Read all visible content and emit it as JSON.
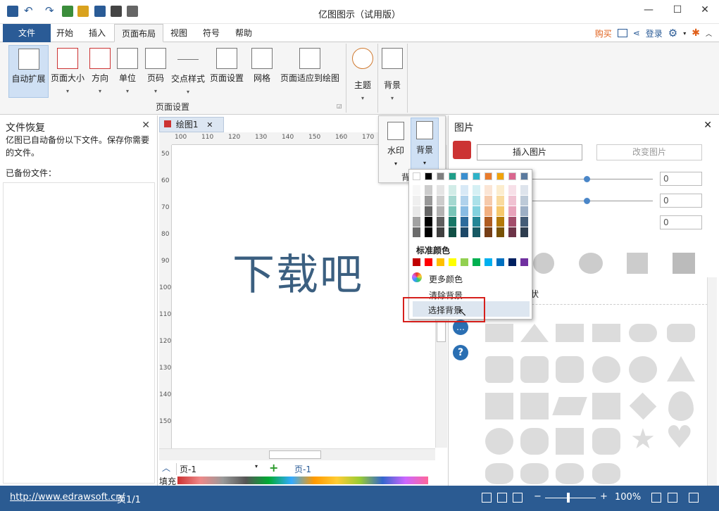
{
  "app": {
    "title": "亿图图示（试用版）"
  },
  "window_controls": {
    "minimize": "—",
    "maximize": "☐",
    "close": "✕"
  },
  "menu": {
    "tabs": [
      "文件",
      "开始",
      "插入",
      "页面布局",
      "视图",
      "符号",
      "帮助"
    ],
    "active": "页面布局",
    "buy": "购买",
    "login": "登录"
  },
  "ribbon": {
    "buttons": [
      "自动扩展",
      "页面大小",
      "方向",
      "单位",
      "页码",
      "交点样式",
      "页面设置",
      "网格",
      "页面适应到绘图"
    ],
    "group_label": "页面设置",
    "theme": "主题",
    "background": "背景",
    "arrow": "▾"
  },
  "left_panel": {
    "title": "文件恢复",
    "close": "✕",
    "description": "亿图已自动备份以下文件。保存你需要的文件。",
    "files_label": "已备份文件："
  },
  "document": {
    "tab_label": "绘图1",
    "tab_close": "✕",
    "canvas_text": "下载吧",
    "ruler_h": [
      "100",
      "110",
      "120",
      "130",
      "140",
      "150",
      "160",
      "170"
    ],
    "ruler_v": [
      "50",
      "60",
      "70",
      "80",
      "90",
      "100",
      "110",
      "120",
      "130",
      "140",
      "150"
    ]
  },
  "page_bar": {
    "page_select": "页-1",
    "add": "+",
    "current_page": "页-1",
    "fill_label": "填充"
  },
  "watermark_popup": {
    "watermark": "水印",
    "background": "背景",
    "partial": "背"
  },
  "color_menu": {
    "theme_colors": [
      "#ffffff",
      "#000000",
      "#7f7f7f",
      "#1f9e89",
      "#3a8fd0",
      "#2eb3c8",
      "#e97b2c",
      "#f0a30a",
      "#d9668e",
      "#5b7a9e"
    ],
    "standard_label": "标准颜色",
    "standard_colors": [
      "#c00000",
      "#ff0000",
      "#ffc000",
      "#ffff00",
      "#92d050",
      "#00b050",
      "#00b0f0",
      "#0070c0",
      "#002060",
      "#7030a0"
    ],
    "more_colors": "更多颜色",
    "clear_background": "清除背景",
    "choose_background": "选择背景"
  },
  "right_panel": {
    "title": "图片",
    "close": "✕",
    "insert_picture": "插入图片",
    "change_picture": "改变图片",
    "spin_values": [
      "0",
      "0",
      "0"
    ],
    "partial_label": "状"
  },
  "status": {
    "url": "http://www.edrawsoft.cn/",
    "page": "页1/1",
    "zoom": "100%"
  }
}
